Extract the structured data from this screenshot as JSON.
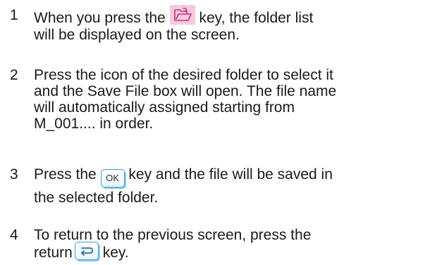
{
  "steps": [
    {
      "number": "1",
      "text_before_key": "When you press the",
      "key_icon": "folder-open-icon",
      "text_after_key": " key, the folder list",
      "text_line2": "will be displayed on the screen."
    },
    {
      "number": "2",
      "lines": [
        "Press the icon of the desired folder to select it",
        "and the Save File box will open. The file name",
        "will automatically assigned starting from",
        "M_001.... in order."
      ]
    },
    {
      "number": "3",
      "text_before_key": "Press the",
      "key_label": "OK",
      "text_after_key": " key and the file will be saved in",
      "text_line2": "the selected folder."
    },
    {
      "number": "4",
      "text_line1": "To return to the previous screen, press the",
      "text_before_key": "return",
      "key_icon": "return-icon",
      "text_after_key": " key."
    }
  ],
  "colors": {
    "folder_key_bg": "#f6c9dc",
    "button_border": "#3aa0c9",
    "text": "#1a1a1a"
  }
}
